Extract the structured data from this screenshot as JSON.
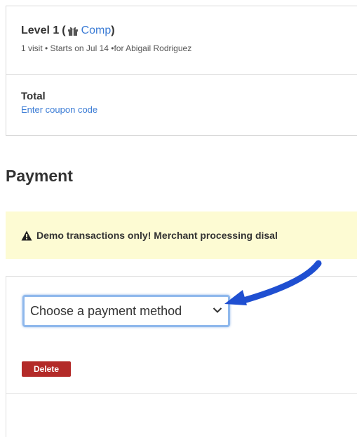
{
  "order": {
    "item": {
      "title": "Level 1",
      "paren_open": "(",
      "comp_label": "Comp",
      "paren_close": ")",
      "gift_icon": "gift-icon",
      "subtitle": "1 visit • Starts on Jul 14 •for Abigail Rodriguez"
    },
    "total_label": "Total",
    "coupon_link": "Enter coupon code"
  },
  "payment": {
    "heading": "Payment",
    "warning": {
      "icon": "warning-icon",
      "text": "Demo transactions only! Merchant processing disal"
    },
    "method_select": {
      "selected": "Choose a payment method",
      "icon": "chevron-down-icon"
    },
    "delete_label": "Delete"
  },
  "colors": {
    "link": "#3a7bd5",
    "warning_bg": "#fdfbd3",
    "delete_bg": "#b32a28",
    "select_border": "#8fb8ec",
    "annotation_arrow": "#1f4fd1"
  }
}
